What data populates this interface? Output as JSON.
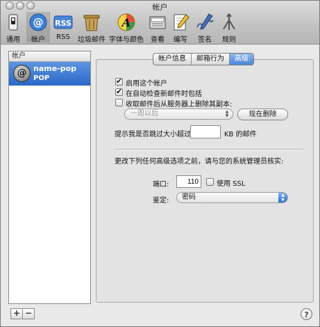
{
  "window": {
    "title": "帐户"
  },
  "toolbar": {
    "items": [
      {
        "label": "通用",
        "icon": "switch-icon"
      },
      {
        "label": "帐户",
        "icon": "at-sign-icon"
      },
      {
        "label": "RSS",
        "icon": "rss-icon"
      },
      {
        "label": "垃圾邮件",
        "icon": "junk-mail-icon"
      },
      {
        "label": "字体与颜色",
        "icon": "fonts-colors-icon"
      },
      {
        "label": "查看",
        "icon": "view-icon"
      },
      {
        "label": "编写",
        "icon": "compose-icon"
      },
      {
        "label": "签名",
        "icon": "signature-icon"
      },
      {
        "label": "规则",
        "icon": "rules-icon"
      }
    ],
    "selected": "帐户"
  },
  "sidebar": {
    "header": "帐户",
    "accounts": [
      {
        "name": "name-pop",
        "type": "POP",
        "icon": "at-sign-icon"
      }
    ],
    "add_label": "+",
    "remove_label": "−"
  },
  "tabs": {
    "items": [
      "帐户信息",
      "邮箱行为",
      "高级"
    ],
    "active": "高级"
  },
  "advanced": {
    "enable_account": {
      "label": "启用这个帐户",
      "checked": true
    },
    "include_auto_check": {
      "label": "在自动检查新邮件时包括",
      "checked": true
    },
    "remove_copy": {
      "label": "收取邮件后从服务器上删除其副本:",
      "checked": false
    },
    "remove_after": {
      "value": "一周以后",
      "enabled": false
    },
    "remove_now_label": "现在删除",
    "size_prompt": {
      "before": "提示我是否跳过大小超过",
      "value": "",
      "after": "KB 的邮件"
    },
    "warning": "更改下列任何高级选项之前，请与您的系统管理员核实:",
    "port": {
      "label": "端口:",
      "value": "110"
    },
    "use_ssl": {
      "label": "使用 SSL",
      "checked": false
    },
    "auth": {
      "label": "鉴定:",
      "value": "密码"
    }
  },
  "help_label": "?",
  "colors": {
    "selection": "#2f6fd0",
    "pane": "#e3e3e3",
    "chrome": "#c2c2c2"
  }
}
